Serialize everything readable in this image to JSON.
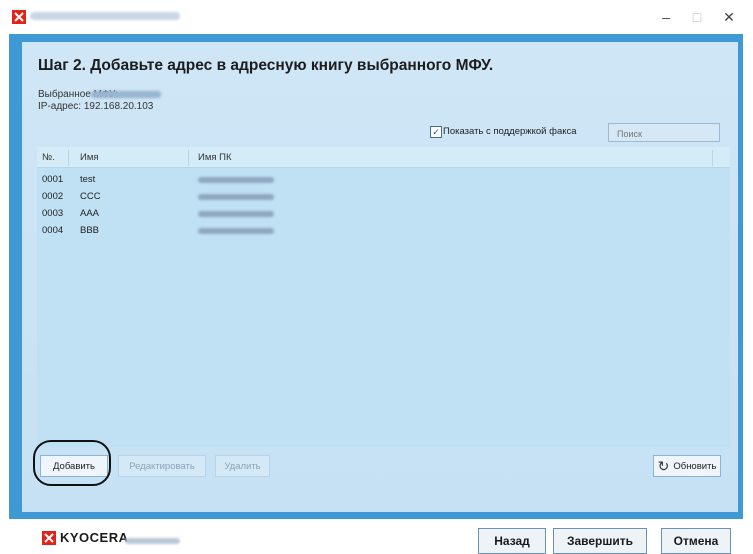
{
  "window": {
    "minimize": "–",
    "maximize": "□",
    "close": "✕"
  },
  "header": {
    "step_title": "Шаг 2. Добавьте адрес в адресную книгу выбранного МФУ.",
    "mfp_label": "Выбранное МФУ:",
    "ip_label": "IP-адрес: 192.168.20.103"
  },
  "filters": {
    "fax_checked": true,
    "fax_label": "Показать с поддержкой факса",
    "search_placeholder": "Поиск"
  },
  "table": {
    "columns": [
      "№.",
      "Имя",
      "Имя ПК"
    ],
    "rows": [
      {
        "no": "0001",
        "name": "test"
      },
      {
        "no": "0002",
        "name": "CCC"
      },
      {
        "no": "0003",
        "name": "AAA"
      },
      {
        "no": "0004",
        "name": "BBB"
      }
    ]
  },
  "actions": {
    "add": "Добавить",
    "edit": "Редактировать",
    "delete": "Удалить",
    "refresh": "Обновить"
  },
  "footer": {
    "logo": "KYOCERA",
    "back": "Назад",
    "finish": "Завершить",
    "cancel": "Отмена"
  },
  "colors": {
    "frame": "#3f99d4",
    "panel": "#c6e1f4",
    "brand_red": "#e2231a"
  },
  "icons": {
    "app": "kyocera-mark-icon",
    "refresh": "refresh-icon"
  }
}
